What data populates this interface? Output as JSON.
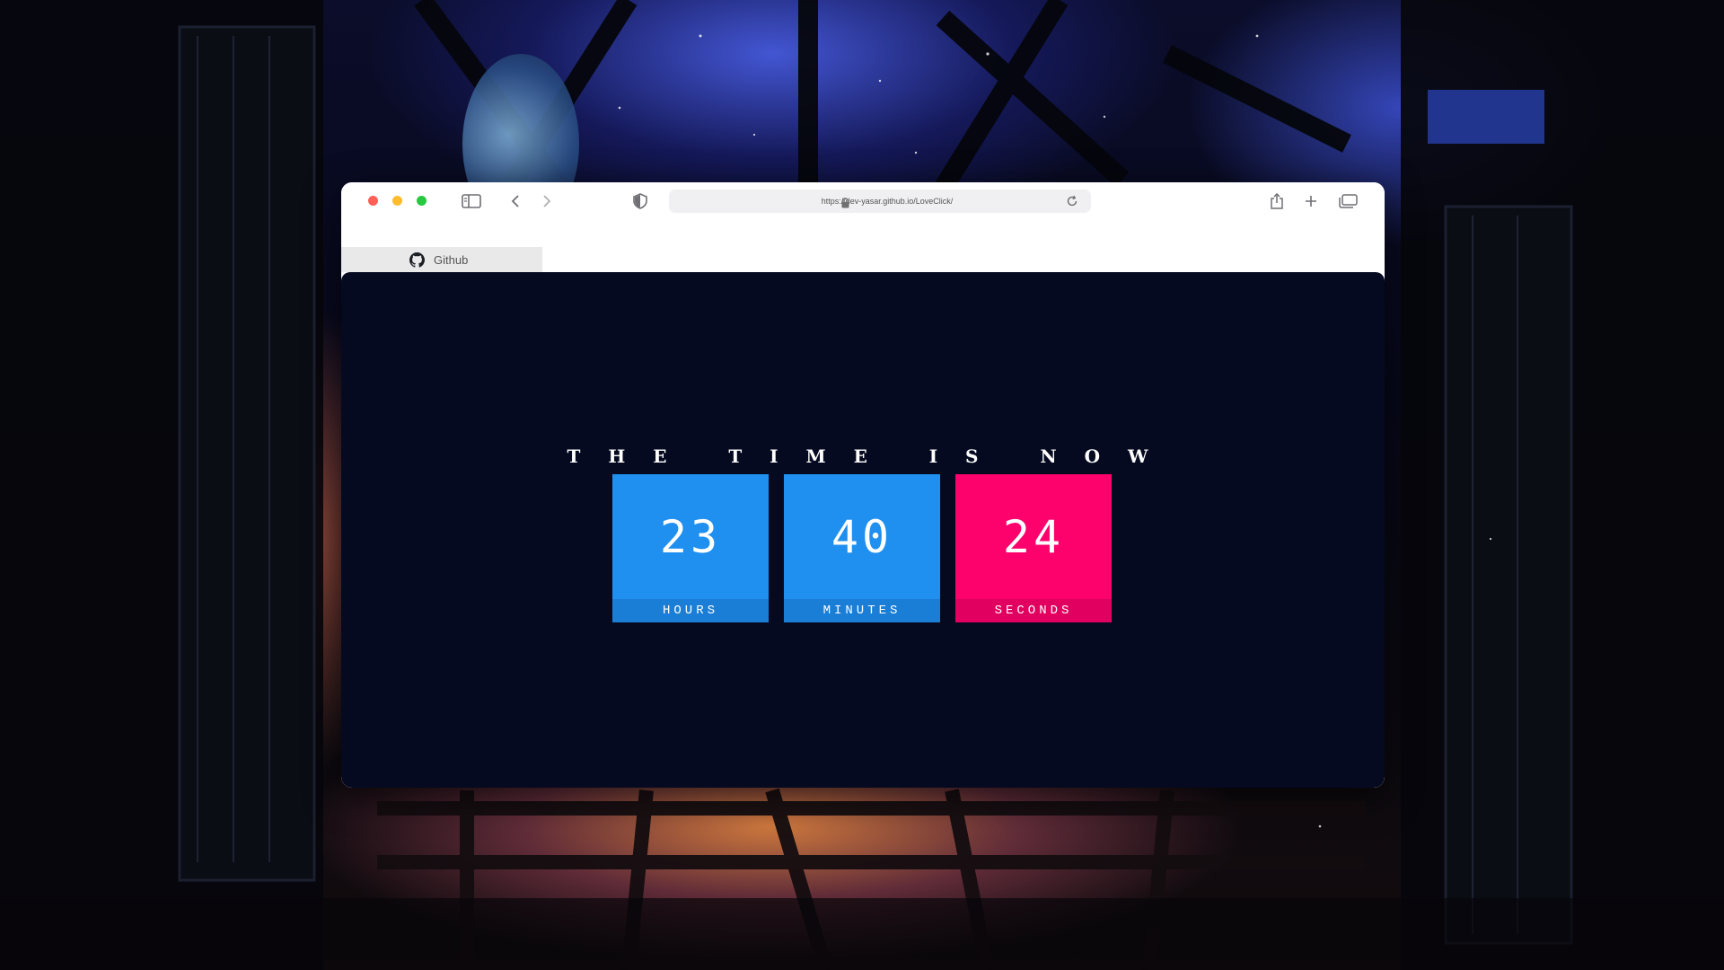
{
  "browser": {
    "url": "https://dev-yasar.github.io/LoveClick/",
    "tab": {
      "label": "Github"
    }
  },
  "page": {
    "headline": "T H E   T I M E   I S   N O W",
    "timer": [
      {
        "value": "23",
        "label": "HOURS"
      },
      {
        "value": "40",
        "label": "MINUTES"
      },
      {
        "value": "24",
        "label": "SECONDS"
      }
    ]
  },
  "colors": {
    "page_background": "#050a20",
    "blue_box": "#1f8ff0",
    "blue_label": "#1a7ed6",
    "pink_box": "#fd016d",
    "pink_label": "#e1005f"
  }
}
